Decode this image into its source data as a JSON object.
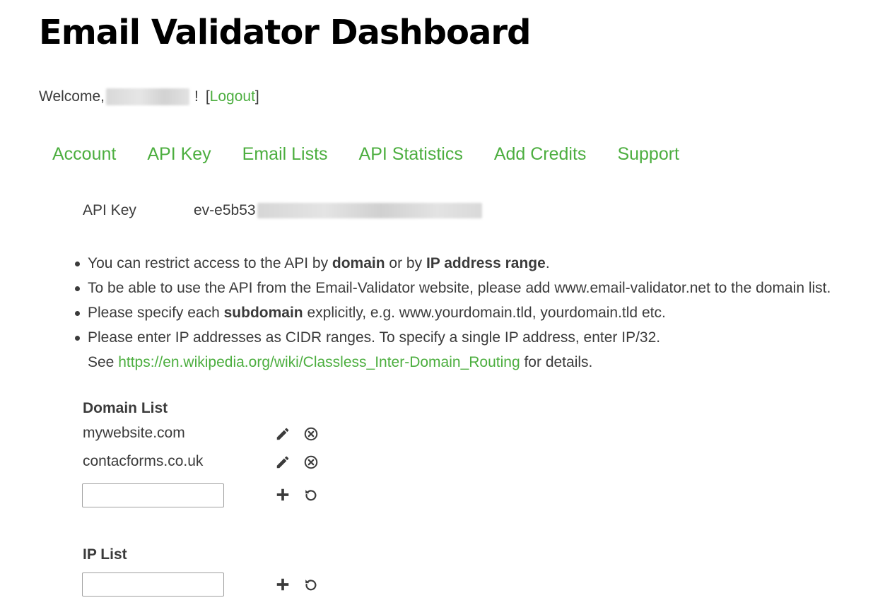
{
  "header": {
    "title": "Email Validator Dashboard"
  },
  "welcome": {
    "prefix": "Welcome,",
    "suffix": "!",
    "bracket_open": "[",
    "logout": "Logout",
    "bracket_close": "]"
  },
  "nav": {
    "items": [
      "Account",
      "API Key",
      "Email Lists",
      "API Statistics",
      "Add Credits",
      "Support"
    ]
  },
  "api_key": {
    "label": "API Key",
    "value_visible": "ev-e5b53"
  },
  "info": {
    "b1_pre": "You can restrict access to the API by ",
    "b1_bold1": "domain",
    "b1_mid": " or by ",
    "b1_bold2": "IP address range",
    "b1_post": ".",
    "b2": "To be able to use the API from the Email-Validator website, please add www.email-validator.net to the domain list.",
    "b3_pre": "Please specify each ",
    "b3_bold": "subdomain",
    "b3_post": " explicitly, e.g. www.yourdomain.tld, yourdomain.tld etc.",
    "b4": "Please enter IP addresses as CIDR ranges. To specify a single IP address, enter IP/32.",
    "b4_see": "See ",
    "b4_link": "https://en.wikipedia.org/wiki/Classless_Inter-Domain_Routing",
    "b4_post": " for details."
  },
  "domain_list": {
    "title": "Domain List",
    "items": [
      "mywebsite.com",
      "contacforms.co.uk"
    ],
    "input_value": ""
  },
  "ip_list": {
    "title": "IP List",
    "input_value": ""
  },
  "icons": {
    "edit": "pencil-icon",
    "delete": "circle-x-icon",
    "add": "plus-icon",
    "reset": "undo-icon"
  },
  "colors": {
    "link": "#4cae3f",
    "text": "#3b3b3b",
    "title": "#000000"
  }
}
